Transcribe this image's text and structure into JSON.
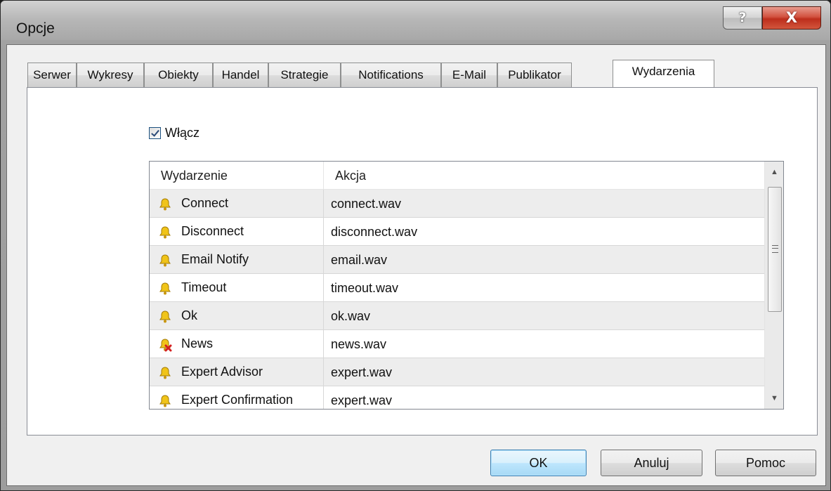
{
  "window": {
    "title": "Opcje",
    "help_glyph": "?",
    "close_glyph": "X"
  },
  "tabs": [
    {
      "label": "Serwer"
    },
    {
      "label": "Wykresy"
    },
    {
      "label": "Obiekty"
    },
    {
      "label": "Handel"
    },
    {
      "label": "Strategie"
    },
    {
      "label": "Notifications"
    },
    {
      "label": "E-Mail"
    },
    {
      "label": "Publikator"
    },
    {
      "label": "Wydarzenia",
      "selected": true
    }
  ],
  "events": {
    "enable_label": "Włącz",
    "enable_checked": true,
    "columns": {
      "event": "Wydarzenie",
      "action": "Akcja"
    },
    "rows": [
      {
        "event": "Connect",
        "action": "connect.wav",
        "icon": "bell-icon"
      },
      {
        "event": "Disconnect",
        "action": "disconnect.wav",
        "icon": "bell-icon"
      },
      {
        "event": "Email Notify",
        "action": "email.wav",
        "icon": "bell-icon"
      },
      {
        "event": "Timeout",
        "action": "timeout.wav",
        "icon": "bell-icon"
      },
      {
        "event": "Ok",
        "action": "ok.wav",
        "icon": "bell-icon"
      },
      {
        "event": "News",
        "action": "news.wav",
        "icon": "bell-disabled-icon"
      },
      {
        "event": "Expert Advisor",
        "action": "expert.wav",
        "icon": "bell-icon"
      },
      {
        "event": "Expert Confirmation",
        "action": "expert.wav",
        "icon": "bell-icon"
      }
    ]
  },
  "buttons": {
    "ok": "OK",
    "cancel": "Anuluj",
    "help": "Pomoc"
  },
  "colors": {
    "bell": "#f0c419",
    "disabled_x": "#d42020",
    "default_button": "#bee6fd"
  }
}
